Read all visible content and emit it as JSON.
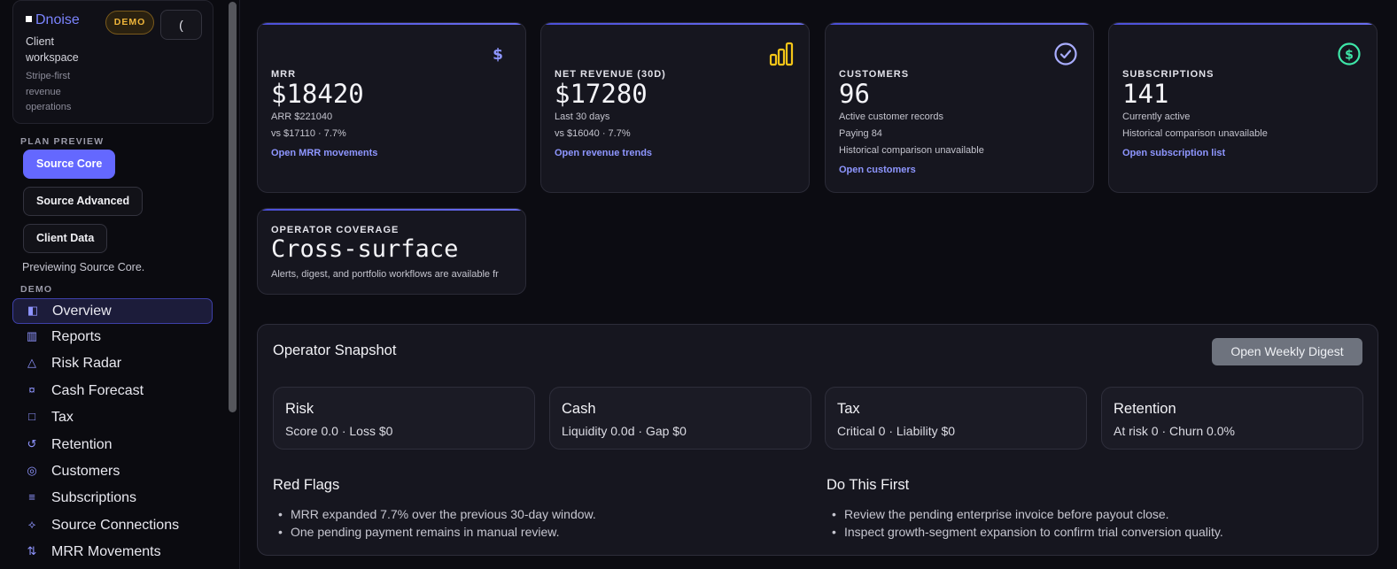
{
  "sidebar": {
    "brand": "Dnoise",
    "workspace": "Client workspace",
    "tagline": "Stripe-first revenue operations",
    "demo_badge": "DEMO",
    "collapse_label": "(",
    "plan_preview_label": "PLAN PREVIEW",
    "plans": [
      "Source Core",
      "Source Advanced",
      "Client Data"
    ],
    "active_plan": "Source Core",
    "preview_text": "Previewing Source Core.",
    "demo_label": "DEMO",
    "nav": [
      {
        "label": "Overview",
        "icon": "sidebar-panel-icon",
        "glyph": "◧",
        "active": true
      },
      {
        "label": "Reports",
        "icon": "bars-icon",
        "glyph": "▥",
        "active": false
      },
      {
        "label": "Risk Radar",
        "icon": "triangle-icon",
        "glyph": "△",
        "active": false
      },
      {
        "label": "Cash Forecast",
        "icon": "currency-icon",
        "glyph": "¤",
        "active": false
      },
      {
        "label": "Tax",
        "icon": "square-icon",
        "glyph": "□",
        "active": false
      },
      {
        "label": "Retention",
        "icon": "refresh-icon",
        "glyph": "↺",
        "active": false
      },
      {
        "label": "Customers",
        "icon": "target-icon",
        "glyph": "◎",
        "active": false
      },
      {
        "label": "Subscriptions",
        "icon": "list-icon",
        "glyph": "≡",
        "active": false
      },
      {
        "label": "Source Connections",
        "icon": "diamond-icon",
        "glyph": "⟡",
        "active": false
      },
      {
        "label": "MRR Movements",
        "icon": "swap-icon",
        "glyph": "⇅",
        "active": false
      }
    ]
  },
  "kpis": [
    {
      "title": "MRR",
      "value": "$18420",
      "lines": [
        "ARR $221040",
        "vs $17110 · 7.7%"
      ],
      "link": "Open MRR movements",
      "icon": "dollar-icon",
      "icon_color": "#8e96ff"
    },
    {
      "title": "NET REVENUE (30D)",
      "value": "$17280",
      "lines": [
        "Last 30 days",
        "vs $16040 · 7.7%"
      ],
      "link": "Open revenue trends",
      "icon": "bar-chart-icon",
      "icon_color": "#f5c518"
    },
    {
      "title": "CUSTOMERS",
      "value": "96",
      "lines": [
        "Active customer records",
        "Paying 84",
        "Historical comparison unavailable"
      ],
      "link": "Open customers",
      "icon": "check-circle-icon",
      "icon_color": "#a9adff"
    },
    {
      "title": "SUBSCRIPTIONS",
      "value": "141",
      "lines": [
        "Currently active",
        "Historical comparison unavailable"
      ],
      "link": "Open subscription list",
      "icon": "dollar-circle-icon",
      "icon_color": "#3ee6a8"
    }
  ],
  "coverage": {
    "title": "OPERATOR COVERAGE",
    "value": "Cross-surface",
    "description": "Alerts, digest, and portfolio workflows are available fr"
  },
  "snapshot": {
    "title": "Operator Snapshot",
    "digest_button": "Open Weekly Digest",
    "cards": [
      {
        "title": "Risk",
        "value": "Score 0.0 · Loss $0"
      },
      {
        "title": "Cash",
        "value": "Liquidity 0.0d · Gap $0"
      },
      {
        "title": "Tax",
        "value": "Critical 0 · Liability $0"
      },
      {
        "title": "Retention",
        "value": "At risk 0 · Churn 0.0%"
      }
    ],
    "red_flags_title": "Red Flags",
    "red_flags": [
      "MRR expanded 7.7% over the previous 30-day window.",
      "One pending payment remains in manual review."
    ],
    "do_first_title": "Do This First",
    "do_first": [
      "Review the pending enterprise invoice before payout close.",
      "Inspect growth-segment expansion to confirm trial conversion quality."
    ]
  }
}
